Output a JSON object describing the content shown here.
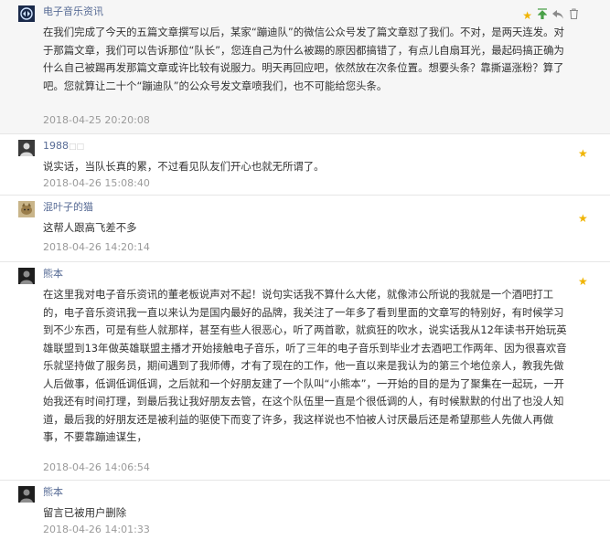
{
  "colors": {
    "accent_star": "#f0b400",
    "link": "#576b95",
    "muted": "#9a9a9a",
    "top_bg": "#f6f6f6"
  },
  "comments": [
    {
      "name": "电子音乐资讯",
      "avatar": "author-logo-icon",
      "text": "在我们完成了今天的五篇文章撰写以后，某家“蹦迪队”的微信公众号发了篇文章怼了我们。不对，是两天连发。对于那篇文章，我们可以告诉那位“队长”，您连自己为什么被踢的原因都搞错了，有点儿自扇耳光，最起码搞正确为什么自己被踢再发那篇文章或许比较有说服力。明天再回应吧，依然放在次条位置。想要头条？靠撕逼涨粉？算了吧。您就算让二十个“蹦迪队”的公众号发文章喷我们，也不可能给您头条。",
      "time": "2018-04-25 20:20:08",
      "actions": [
        "star-icon",
        "pin-top-icon",
        "reply-icon",
        "delete-icon"
      ]
    },
    {
      "name": "1988",
      "name_mark": "□□",
      "avatar": "user-photo-icon",
      "text": "说实话，当队长真的累，不过看见队友们开心也就无所谓了。",
      "time": "2018-04-26 15:08:40"
    },
    {
      "name": "混叶子的猫",
      "avatar": "cat-photo-icon",
      "text": "这帮人跟高飞差不多",
      "time": "2018-04-26 14:20:14"
    },
    {
      "name": "熊本",
      "avatar": "user-photo-icon",
      "text": "在这里我对电子音乐资讯的董老板说声对不起！说句实话我不算什么大佬，就像沛公所说的我就是一个酒吧打工的，电子音乐资讯我一直以来认为是国内最好的品牌，我关注了一年多了看到里面的文章写的特别好，有时候学习到不少东西，可是有些人就那样，甚至有些人很恶心，听了两首歌，就疯狂的吹水，说实话我从12年读书开始玩英雄联盟到13年做英雄联盟主播才开始接触电子音乐，听了三年的电子音乐到毕业才去酒吧工作两年、因为很喜欢音乐就坚持做了服务员，期间遇到了我师傅，才有了现在的工作，他一直以来是我认为的第三个地位亲人，教我先做人后做事，低调低调低调，之后就和一个好朋友建了一个队叫“小熊本”，一开始的目的是为了聚集在一起玩，一开始我还有时间打理，到最后我让我好朋友去管，在这个队伍里一直是个很低调的人，有时候默默的付出了也没人知道，最后我的好朋友还是被利益的驱使下而变了许多，我这样说也不怕被人讨厌最后还是希望那些人先做人再做事，不要靠蹦迪谋生，",
      "time": "2018-04-26 14:06:54"
    },
    {
      "name": "熊本",
      "avatar": "user-photo-icon",
      "text": "留言已被用户删除",
      "time": "2018-04-26 14:01:33"
    }
  ]
}
